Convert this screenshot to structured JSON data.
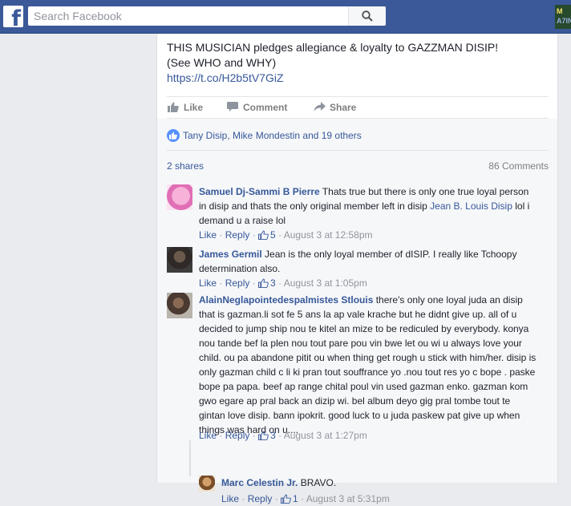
{
  "topbar": {
    "logo_letter": "f",
    "search_placeholder": "Search Facebook",
    "corner_badge_top": "M",
    "corner_badge_bottom": "A7IN"
  },
  "post": {
    "line1": "THIS MUSICIAN pledges allegiance & loyalty to GAZZMAN DISIP!",
    "line2": "(See WHO and WHY)",
    "link": "https://t.co/H2b5tV7GiZ"
  },
  "actions": {
    "like": "Like",
    "comment": "Comment",
    "share": "Share"
  },
  "reactions": {
    "text": "Tany Disip, Mike Mondestin and 19 others"
  },
  "shares": {
    "label": "2 shares",
    "comments_count": "86 Comments"
  },
  "comments": [
    {
      "name": "Samuel Dj-Sammi B Pierre",
      "text1": " Thats true but there is only one true loyal person",
      "text2": "in disip and thats the only original member left in disip ",
      "mention": "Jean B. Louis Disip",
      "text3": " lol i",
      "text4": "demand u a raise lol",
      "like": "Like",
      "reply": "Reply",
      "likes": "5",
      "time": "August 3 at 12:58pm"
    },
    {
      "name": "James Germil",
      "text1": " Jean is the only loyal member of dISIP. I really like Tchoopy",
      "text2": "determination also.",
      "like": "Like",
      "reply": "Reply",
      "likes": "3",
      "time": "August 3 at 1:05pm"
    },
    {
      "name": "AlainNeglapointedespalmistes Stlouis",
      "lines": [
        " there's only one loyal juda an disip",
        "that is gazman.li sot fe 5 ans la ap vale krache but he didnt give up. all of u",
        "decided to jump ship nou te kitel an mize to be rediculed by everybody. konya",
        "nou tande bef la plen nou tout pare pou vin bwe let ou wi u always love your",
        "child. ou pa abandone pitit ou when thing get rough u stick with him/her. disip is",
        "only gazman child c li ki pran tout souffrance yo .nou tout res yo c bope . paske",
        "bope pa papa. beef ap range chital poul vin used gazman enko. gazman kom",
        "gwo egare ap pral back an dizip wi. bel album deyo gig pral tombe tout te",
        "gintan love disip. bann ipokrit. good luck to u juda paskew pat give up when",
        "things was hard on u...."
      ],
      "like": "Like",
      "reply": "Reply",
      "likes": "3",
      "time": "August 3 at 1:27pm"
    },
    {
      "name": "Marc Celestin Jr.",
      "text1": " BRAVO.",
      "like": "Like",
      "reply": "Reply",
      "likes": "1",
      "time": "August 3 at 5:31pm"
    }
  ],
  "colors": {
    "brand_blue": "#3b5998",
    "link_blue": "#365899",
    "reaction_blue": "#5890ff",
    "page_bg": "#e9ebee",
    "meta_gray": "#90949c"
  },
  "icons": [
    "facebook-logo-icon",
    "search-icon",
    "like-thumb-icon",
    "comment-bubble-icon",
    "share-arrow-icon"
  ]
}
